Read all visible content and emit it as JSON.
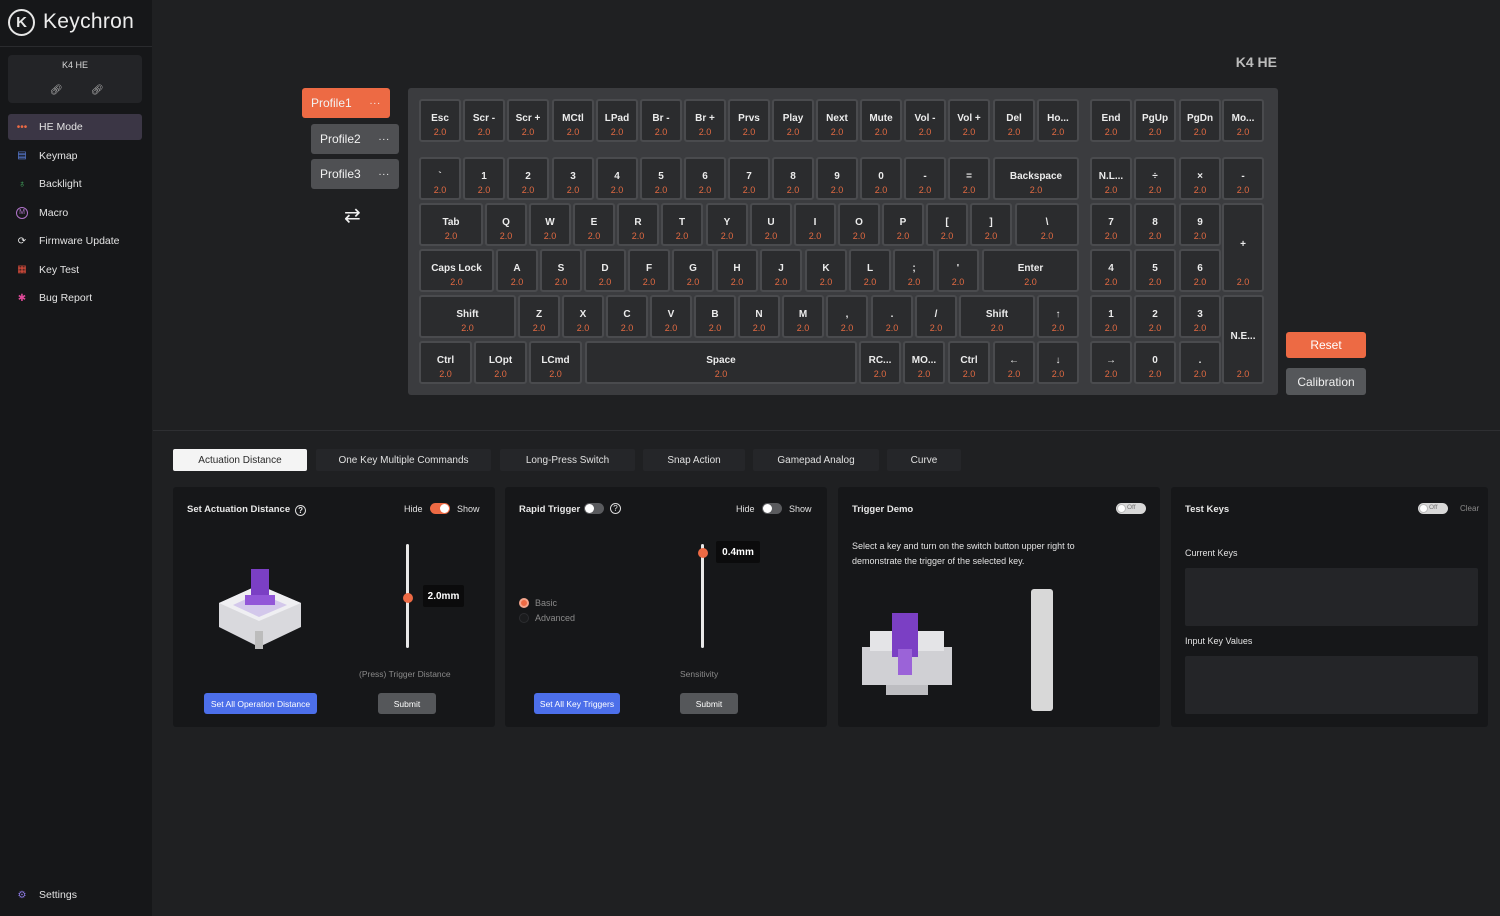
{
  "app": {
    "brand": "Keychron",
    "device": "K4 HE"
  },
  "sidebar": {
    "items": [
      {
        "label": "HE Mode",
        "icon": "he-mode-icon",
        "active": true
      },
      {
        "label": "Keymap",
        "icon": "keymap-icon"
      },
      {
        "label": "Backlight",
        "icon": "backlight-icon"
      },
      {
        "label": "Macro",
        "icon": "macro-icon"
      },
      {
        "label": "Firmware Update",
        "icon": "firmware-update-icon"
      },
      {
        "label": "Key Test",
        "icon": "key-test-icon"
      },
      {
        "label": "Bug Report",
        "icon": "bug-report-icon"
      }
    ],
    "settings": "Settings"
  },
  "profiles": [
    {
      "label": "Profile1",
      "active": true
    },
    {
      "label": "Profile2"
    },
    {
      "label": "Profile3"
    }
  ],
  "profile_menu": "...",
  "keyboard": {
    "title": "K4 HE",
    "keys": [
      {
        "label": "Esc",
        "value": "2.0"
      },
      {
        "label": "Scr -",
        "value": "2.0"
      },
      {
        "label": "Scr +",
        "value": "2.0"
      },
      {
        "label": "MCtl",
        "value": "2.0"
      },
      {
        "label": "LPad",
        "value": "2.0"
      },
      {
        "label": "Br -",
        "value": "2.0"
      },
      {
        "label": "Br +",
        "value": "2.0"
      },
      {
        "label": "Prvs",
        "value": "2.0"
      },
      {
        "label": "Play",
        "value": "2.0"
      },
      {
        "label": "Next",
        "value": "2.0"
      },
      {
        "label": "Mute",
        "value": "2.0"
      },
      {
        "label": "Vol -",
        "value": "2.0"
      },
      {
        "label": "Vol +",
        "value": "2.0"
      },
      {
        "label": "Del",
        "value": "2.0"
      },
      {
        "label": "Ho...",
        "value": "2.0"
      },
      {
        "label": "End",
        "value": "2.0"
      },
      {
        "label": "PgUp",
        "value": "2.0"
      },
      {
        "label": "PgDn",
        "value": "2.0"
      },
      {
        "label": "Mo...",
        "value": "2.0"
      },
      {
        "label": "`",
        "value": "2.0"
      },
      {
        "label": "1",
        "value": "2.0"
      },
      {
        "label": "2",
        "value": "2.0"
      },
      {
        "label": "3",
        "value": "2.0"
      },
      {
        "label": "4",
        "value": "2.0"
      },
      {
        "label": "5",
        "value": "2.0"
      },
      {
        "label": "6",
        "value": "2.0"
      },
      {
        "label": "7",
        "value": "2.0"
      },
      {
        "label": "8",
        "value": "2.0"
      },
      {
        "label": "9",
        "value": "2.0"
      },
      {
        "label": "0",
        "value": "2.0"
      },
      {
        "label": "-",
        "value": "2.0"
      },
      {
        "label": "=",
        "value": "2.0"
      },
      {
        "label": "Backspace",
        "value": "2.0"
      },
      {
        "label": "N.L...",
        "value": "2.0"
      },
      {
        "label": "÷",
        "value": "2.0"
      },
      {
        "label": "×",
        "value": "2.0"
      },
      {
        "label": "-",
        "value": "2.0"
      },
      {
        "label": "Tab",
        "value": "2.0"
      },
      {
        "label": "Q",
        "value": "2.0"
      },
      {
        "label": "W",
        "value": "2.0"
      },
      {
        "label": "E",
        "value": "2.0"
      },
      {
        "label": "R",
        "value": "2.0"
      },
      {
        "label": "T",
        "value": "2.0"
      },
      {
        "label": "Y",
        "value": "2.0"
      },
      {
        "label": "U",
        "value": "2.0"
      },
      {
        "label": "I",
        "value": "2.0"
      },
      {
        "label": "O",
        "value": "2.0"
      },
      {
        "label": "P",
        "value": "2.0"
      },
      {
        "label": "[",
        "value": "2.0"
      },
      {
        "label": "]",
        "value": "2.0"
      },
      {
        "label": "\\",
        "value": "2.0"
      },
      {
        "label": "7",
        "value": "2.0"
      },
      {
        "label": "8",
        "value": "2.0"
      },
      {
        "label": "9",
        "value": "2.0"
      },
      {
        "label": "+",
        "value": "2.0"
      },
      {
        "label": "Caps Lock",
        "value": "2.0"
      },
      {
        "label": "A",
        "value": "2.0"
      },
      {
        "label": "S",
        "value": "2.0"
      },
      {
        "label": "D",
        "value": "2.0"
      },
      {
        "label": "F",
        "value": "2.0"
      },
      {
        "label": "G",
        "value": "2.0"
      },
      {
        "label": "H",
        "value": "2.0"
      },
      {
        "label": "J",
        "value": "2.0"
      },
      {
        "label": "K",
        "value": "2.0"
      },
      {
        "label": "L",
        "value": "2.0"
      },
      {
        "label": ";",
        "value": "2.0"
      },
      {
        "label": "'",
        "value": "2.0"
      },
      {
        "label": "Enter",
        "value": "2.0"
      },
      {
        "label": "4",
        "value": "2.0"
      },
      {
        "label": "5",
        "value": "2.0"
      },
      {
        "label": "6",
        "value": "2.0"
      },
      {
        "label": "Shift",
        "value": "2.0"
      },
      {
        "label": "Z",
        "value": "2.0"
      },
      {
        "label": "X",
        "value": "2.0"
      },
      {
        "label": "C",
        "value": "2.0"
      },
      {
        "label": "V",
        "value": "2.0"
      },
      {
        "label": "B",
        "value": "2.0"
      },
      {
        "label": "N",
        "value": "2.0"
      },
      {
        "label": "M",
        "value": "2.0"
      },
      {
        "label": ",",
        "value": "2.0"
      },
      {
        "label": ".",
        "value": "2.0"
      },
      {
        "label": "/",
        "value": "2.0"
      },
      {
        "label": "Shift",
        "value": "2.0"
      },
      {
        "label": "↑",
        "value": "2.0"
      },
      {
        "label": "1",
        "value": "2.0"
      },
      {
        "label": "2",
        "value": "2.0"
      },
      {
        "label": "3",
        "value": "2.0"
      },
      {
        "label": "N.E...",
        "value": "2.0"
      },
      {
        "label": "Ctrl",
        "value": "2.0"
      },
      {
        "label": "LOpt",
        "value": "2.0"
      },
      {
        "label": "LCmd",
        "value": "2.0"
      },
      {
        "label": "Space",
        "value": "2.0"
      },
      {
        "label": "RC...",
        "value": "2.0"
      },
      {
        "label": "MO...",
        "value": "2.0"
      },
      {
        "label": "Ctrl",
        "value": "2.0"
      },
      {
        "label": "←",
        "value": "2.0"
      },
      {
        "label": "↓",
        "value": "2.0"
      },
      {
        "label": "→",
        "value": "2.0"
      },
      {
        "label": "0",
        "value": "2.0"
      },
      {
        "label": ".",
        "value": "2.0"
      }
    ]
  },
  "actions": {
    "reset": "Reset",
    "calibration": "Calibration"
  },
  "tabs": [
    {
      "label": "Actuation Distance",
      "active": true
    },
    {
      "label": "One Key Multiple Commands"
    },
    {
      "label": "Long-Press Switch"
    },
    {
      "label": "Snap Action"
    },
    {
      "label": "Gamepad Analog"
    },
    {
      "label": "Curve"
    }
  ],
  "actuation": {
    "title": "Set Actuation Distance",
    "hide": "Hide",
    "show": "Show",
    "value": "2.0mm",
    "slider_label": "(Press) Trigger Distance",
    "set_all": "Set All Operation Distance",
    "submit": "Submit"
  },
  "rapid_trigger": {
    "title": "Rapid Trigger",
    "hide": "Hide",
    "show": "Show",
    "value": "0.4mm",
    "mode_basic": "Basic",
    "mode_advanced": "Advanced",
    "slider_label": "Sensitivity",
    "set_all": "Set All Key Triggers",
    "submit": "Submit"
  },
  "trigger_demo": {
    "title": "Trigger Demo",
    "toggle": "Off",
    "description_line1": "Select a key and turn on the switch button upper right to",
    "description_line2": "demonstrate the trigger of the selected key."
  },
  "test_keys": {
    "title": "Test Keys",
    "toggle": "Off",
    "clear": "Clear",
    "current_keys": "Current Keys",
    "input_values": "Input Key Values"
  },
  "colors": {
    "accent": "#ed6a44",
    "blue": "#4c6fea",
    "purple": "#7b3fc4"
  }
}
